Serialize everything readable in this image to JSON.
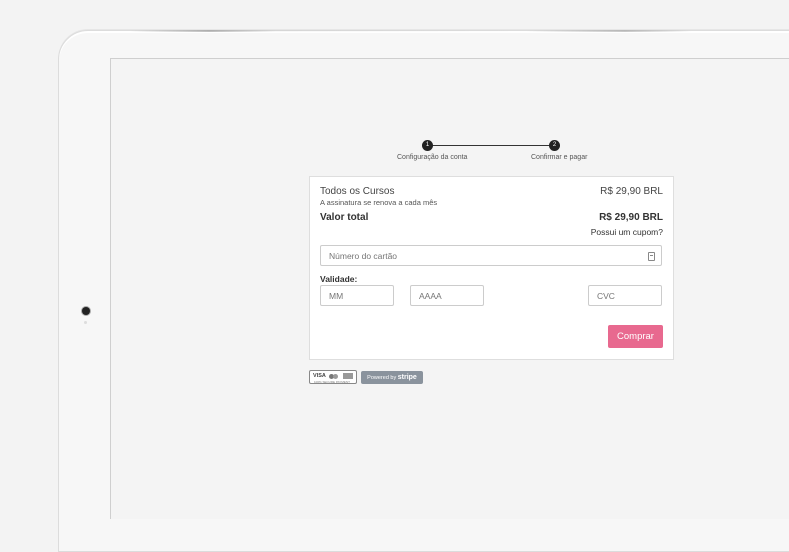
{
  "stepper": {
    "steps": [
      {
        "number": "1",
        "label": "Configuração da conta"
      },
      {
        "number": "2",
        "label": "Confirmar e pagar"
      }
    ]
  },
  "order": {
    "course_name": "Todos os Cursos",
    "course_price": "R$ 29,90 BRL",
    "course_subtitle": "A assinatura se renova a cada mês",
    "total_label": "Valor total",
    "total_price": "R$ 29,90 BRL",
    "coupon_link": "Possui um cupom?"
  },
  "payment": {
    "card_number_placeholder": "Número do cartão",
    "validity_label": "Validade:",
    "month_placeholder": "MM",
    "year_placeholder": "AAAA",
    "cvc_placeholder": "CVC",
    "buy_button": "Comprar"
  },
  "badges": {
    "cards_visa": "VISA",
    "cards_secure_text": "100% SECURE PAYMENT",
    "stripe_prefix": "Powered by",
    "stripe_brand": "stripe"
  },
  "colors": {
    "accent": "#e8698f",
    "stepper": "#222222",
    "stripe_badge": "#8a939d"
  }
}
